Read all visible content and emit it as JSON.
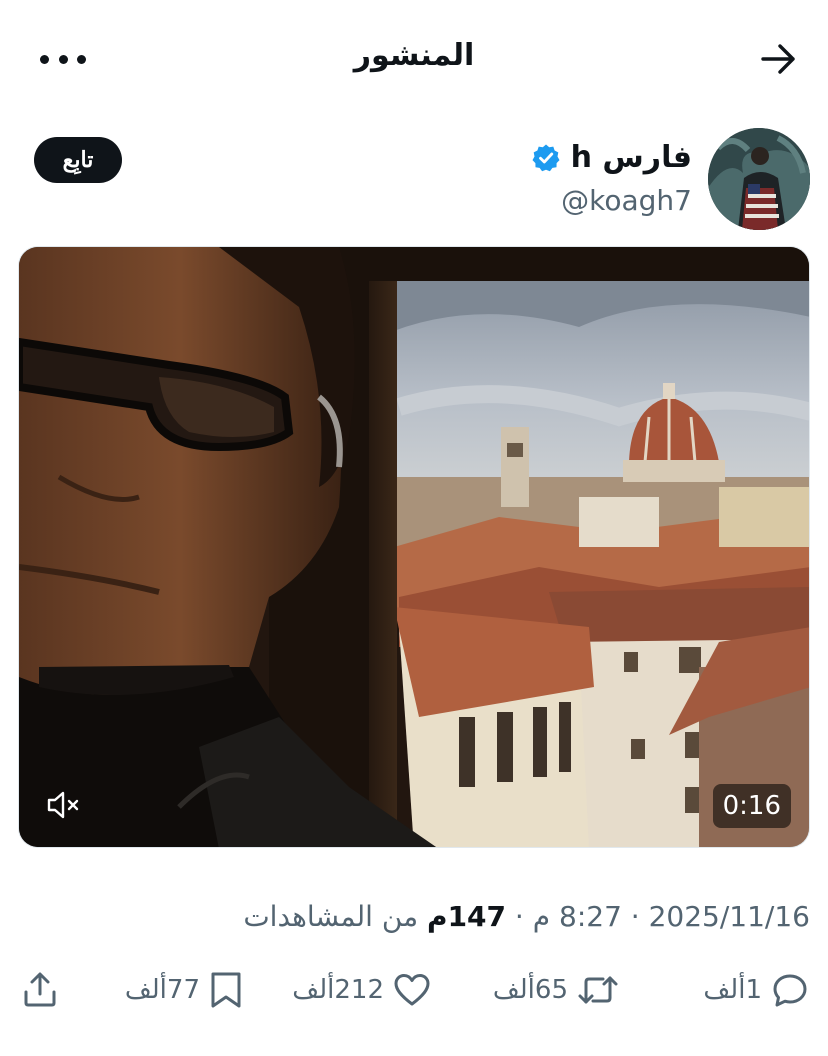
{
  "header": {
    "title": "المنشور"
  },
  "author": {
    "name": "فارس h",
    "handle": "@koagh7",
    "follow_label": "تابِع"
  },
  "video": {
    "duration": "0:16"
  },
  "meta": {
    "date": "2025/11/16",
    "time": "8:27 م",
    "views_count": "147م",
    "views_label": "من المشاهدات"
  },
  "actions": {
    "replies": "1ألف",
    "reposts": "65ألف",
    "likes": "212ألف",
    "bookmarks": "77ألف"
  },
  "colors": {
    "verified": "#1d9bf0",
    "text_secondary": "#536471",
    "text_primary": "#0f1419"
  }
}
